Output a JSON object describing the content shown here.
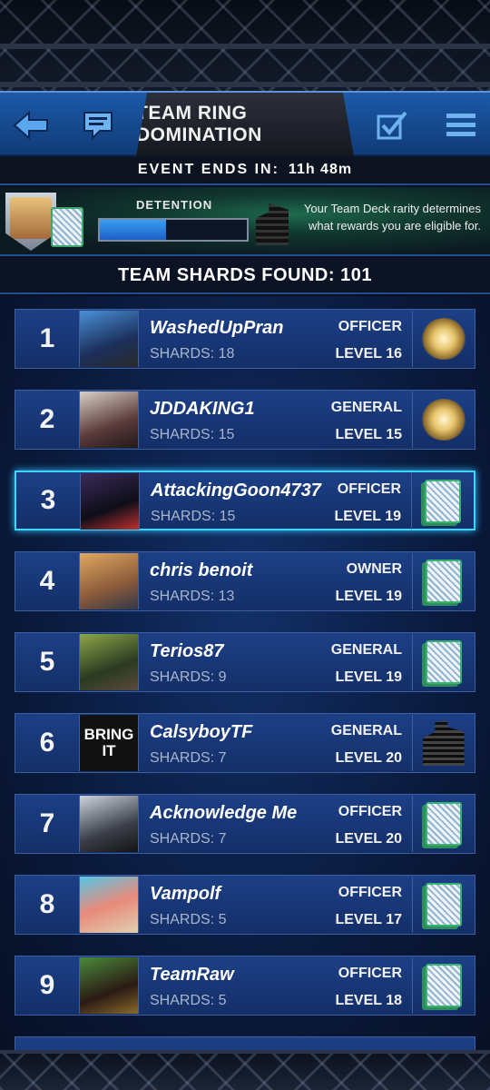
{
  "header": {
    "title": "TEAM RING DOMINATION",
    "icons": [
      "back-arrow-icon",
      "chat-icon",
      "checklist-icon",
      "menu-icon"
    ]
  },
  "event": {
    "ends_label": "EVENT  ENDS  IN:",
    "ends_value": "11h 48m"
  },
  "banner": {
    "label": "DETENTION",
    "progress_fraction": 0.45,
    "message": "Your Team Deck rarity determines what rewards you are eligible for."
  },
  "shards_found": "TEAM SHARDS FOUND: 101",
  "members": [
    {
      "rank": "1",
      "name": "WashedUpPran",
      "shards": "SHARDS: 18",
      "role": "OFFICER",
      "level": "LEVEL 16",
      "reward": "orb",
      "selected": false
    },
    {
      "rank": "2",
      "name": "JDDAKING1",
      "shards": "SHARDS: 15",
      "role": "GENERAL",
      "level": "LEVEL 15",
      "reward": "orb",
      "selected": false
    },
    {
      "rank": "3",
      "name": "AttackingGoon4737",
      "shards": "SHARDS: 15",
      "role": "OFFICER",
      "level": "LEVEL 19",
      "reward": "card",
      "selected": true
    },
    {
      "rank": "4",
      "name": "chris benoit",
      "shards": "SHARDS: 13",
      "role": "OWNER",
      "level": "LEVEL 19",
      "reward": "card",
      "selected": false
    },
    {
      "rank": "5",
      "name": "Terios87",
      "shards": "SHARDS: 9",
      "role": "GENERAL",
      "level": "LEVEL 19",
      "reward": "card",
      "selected": false
    },
    {
      "rank": "6",
      "name": "CalsyboyTF",
      "shards": "SHARDS: 7",
      "role": "GENERAL",
      "level": "LEVEL 20",
      "reward": "building",
      "selected": false,
      "avatar_text": "BRING IT"
    },
    {
      "rank": "7",
      "name": "Acknowledge Me",
      "shards": "SHARDS: 7",
      "role": "OFFICER",
      "level": "LEVEL 20",
      "reward": "card",
      "selected": false
    },
    {
      "rank": "8",
      "name": "Vampolf",
      "shards": "SHARDS: 5",
      "role": "OFFICER",
      "level": "LEVEL 17",
      "reward": "card",
      "selected": false
    },
    {
      "rank": "9",
      "name": "TeamRaw",
      "shards": "SHARDS: 5",
      "role": "OFFICER",
      "level": "LEVEL 18",
      "reward": "card",
      "selected": false
    }
  ],
  "colors": {
    "header_blue": "#1c5aa8",
    "row_blue": "#1c3f86",
    "selection_cyan": "#3fd3ff",
    "card_green": "#38b36f"
  }
}
